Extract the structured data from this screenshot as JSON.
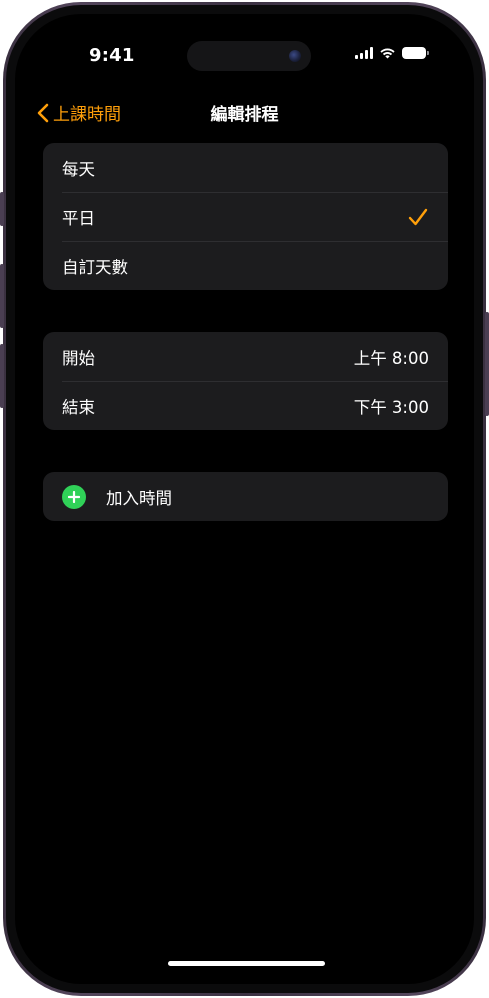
{
  "status_bar": {
    "time": "9:41"
  },
  "nav": {
    "back_label": "上課時間",
    "title": "編輯排程"
  },
  "repeat_options": [
    {
      "label": "每天",
      "selected": false
    },
    {
      "label": "平日",
      "selected": true
    },
    {
      "label": "自訂天數",
      "selected": false
    }
  ],
  "schedule": {
    "start_label": "開始",
    "start_value": "上午 8:00",
    "end_label": "結束",
    "end_value": "下午 3:00"
  },
  "add_time": {
    "label": "加入時間"
  },
  "colors": {
    "accent": "#ff9f0a",
    "add_green": "#30d158",
    "group_bg": "#1c1c1e",
    "screen_bg": "#000000"
  },
  "icons": {
    "back": "chevron-left-icon",
    "check": "checkmark-icon",
    "add": "plus-circle-icon",
    "wifi": "wifi-icon",
    "signal": "cellular-signal-icon",
    "battery": "battery-icon"
  }
}
